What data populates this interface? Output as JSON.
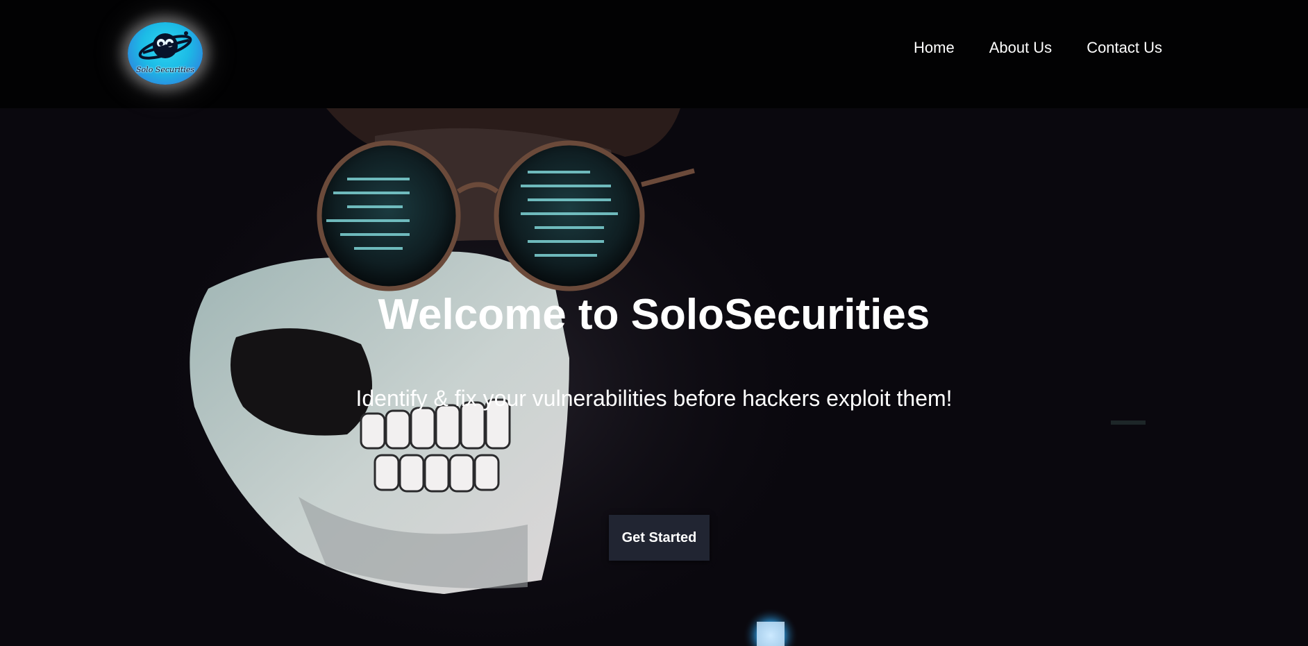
{
  "header": {
    "logo_text": "Solo Securities",
    "nav": [
      {
        "label": "Home"
      },
      {
        "label": "About Us"
      },
      {
        "label": "Contact Us"
      }
    ]
  },
  "hero": {
    "title": "Welcome to SoloSecurities",
    "subtitle": "Identify & fix your vulnerabilities before hackers exploit them!",
    "cta_label": "Get Started",
    "background_image": "masked-hacker-with-glasses-icon"
  },
  "colors": {
    "header_bg": "#020203",
    "cta_bg": "#212532",
    "text": "#ffffff",
    "logo_cyan": "#1cbbe6"
  }
}
